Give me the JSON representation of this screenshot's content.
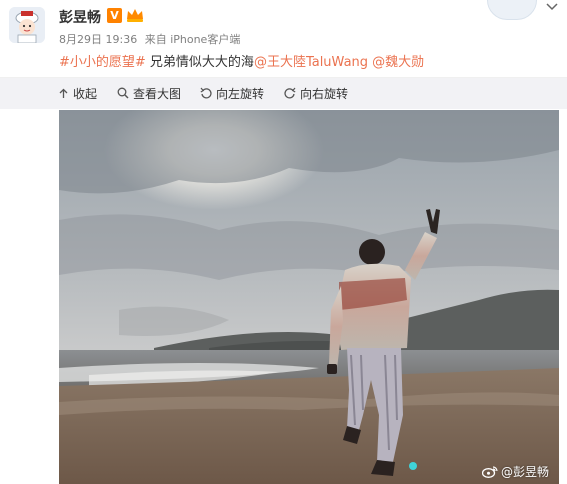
{
  "post": {
    "user_name": "彭昱畅",
    "vip_badge": "V",
    "date": "8月29日 19:36",
    "source": "来自 iPhone客户端",
    "hashtag": "#小小的愿望#",
    "body_text": " 兄弟情似大大的海",
    "mention_1": "@王大陸TaluWang",
    "mention_2": "@魏大勋"
  },
  "toolbar": {
    "collapse_label": "收起",
    "view_large_label": "查看大图",
    "rotate_left_label": "向左旋转",
    "rotate_right_label": "向右旋转"
  },
  "photo": {
    "watermark_handle": "@彭昱畅"
  },
  "colors": {
    "mention": "#eb7350",
    "toolbar_bg": "#f2f2f5",
    "vip": "#ff8200"
  },
  "icons": [
    "collapse-icon",
    "zoom-icon",
    "rotate-left-icon",
    "rotate-right-icon",
    "weibo-logo-icon",
    "crown-icon",
    "chevron-down-icon"
  ]
}
